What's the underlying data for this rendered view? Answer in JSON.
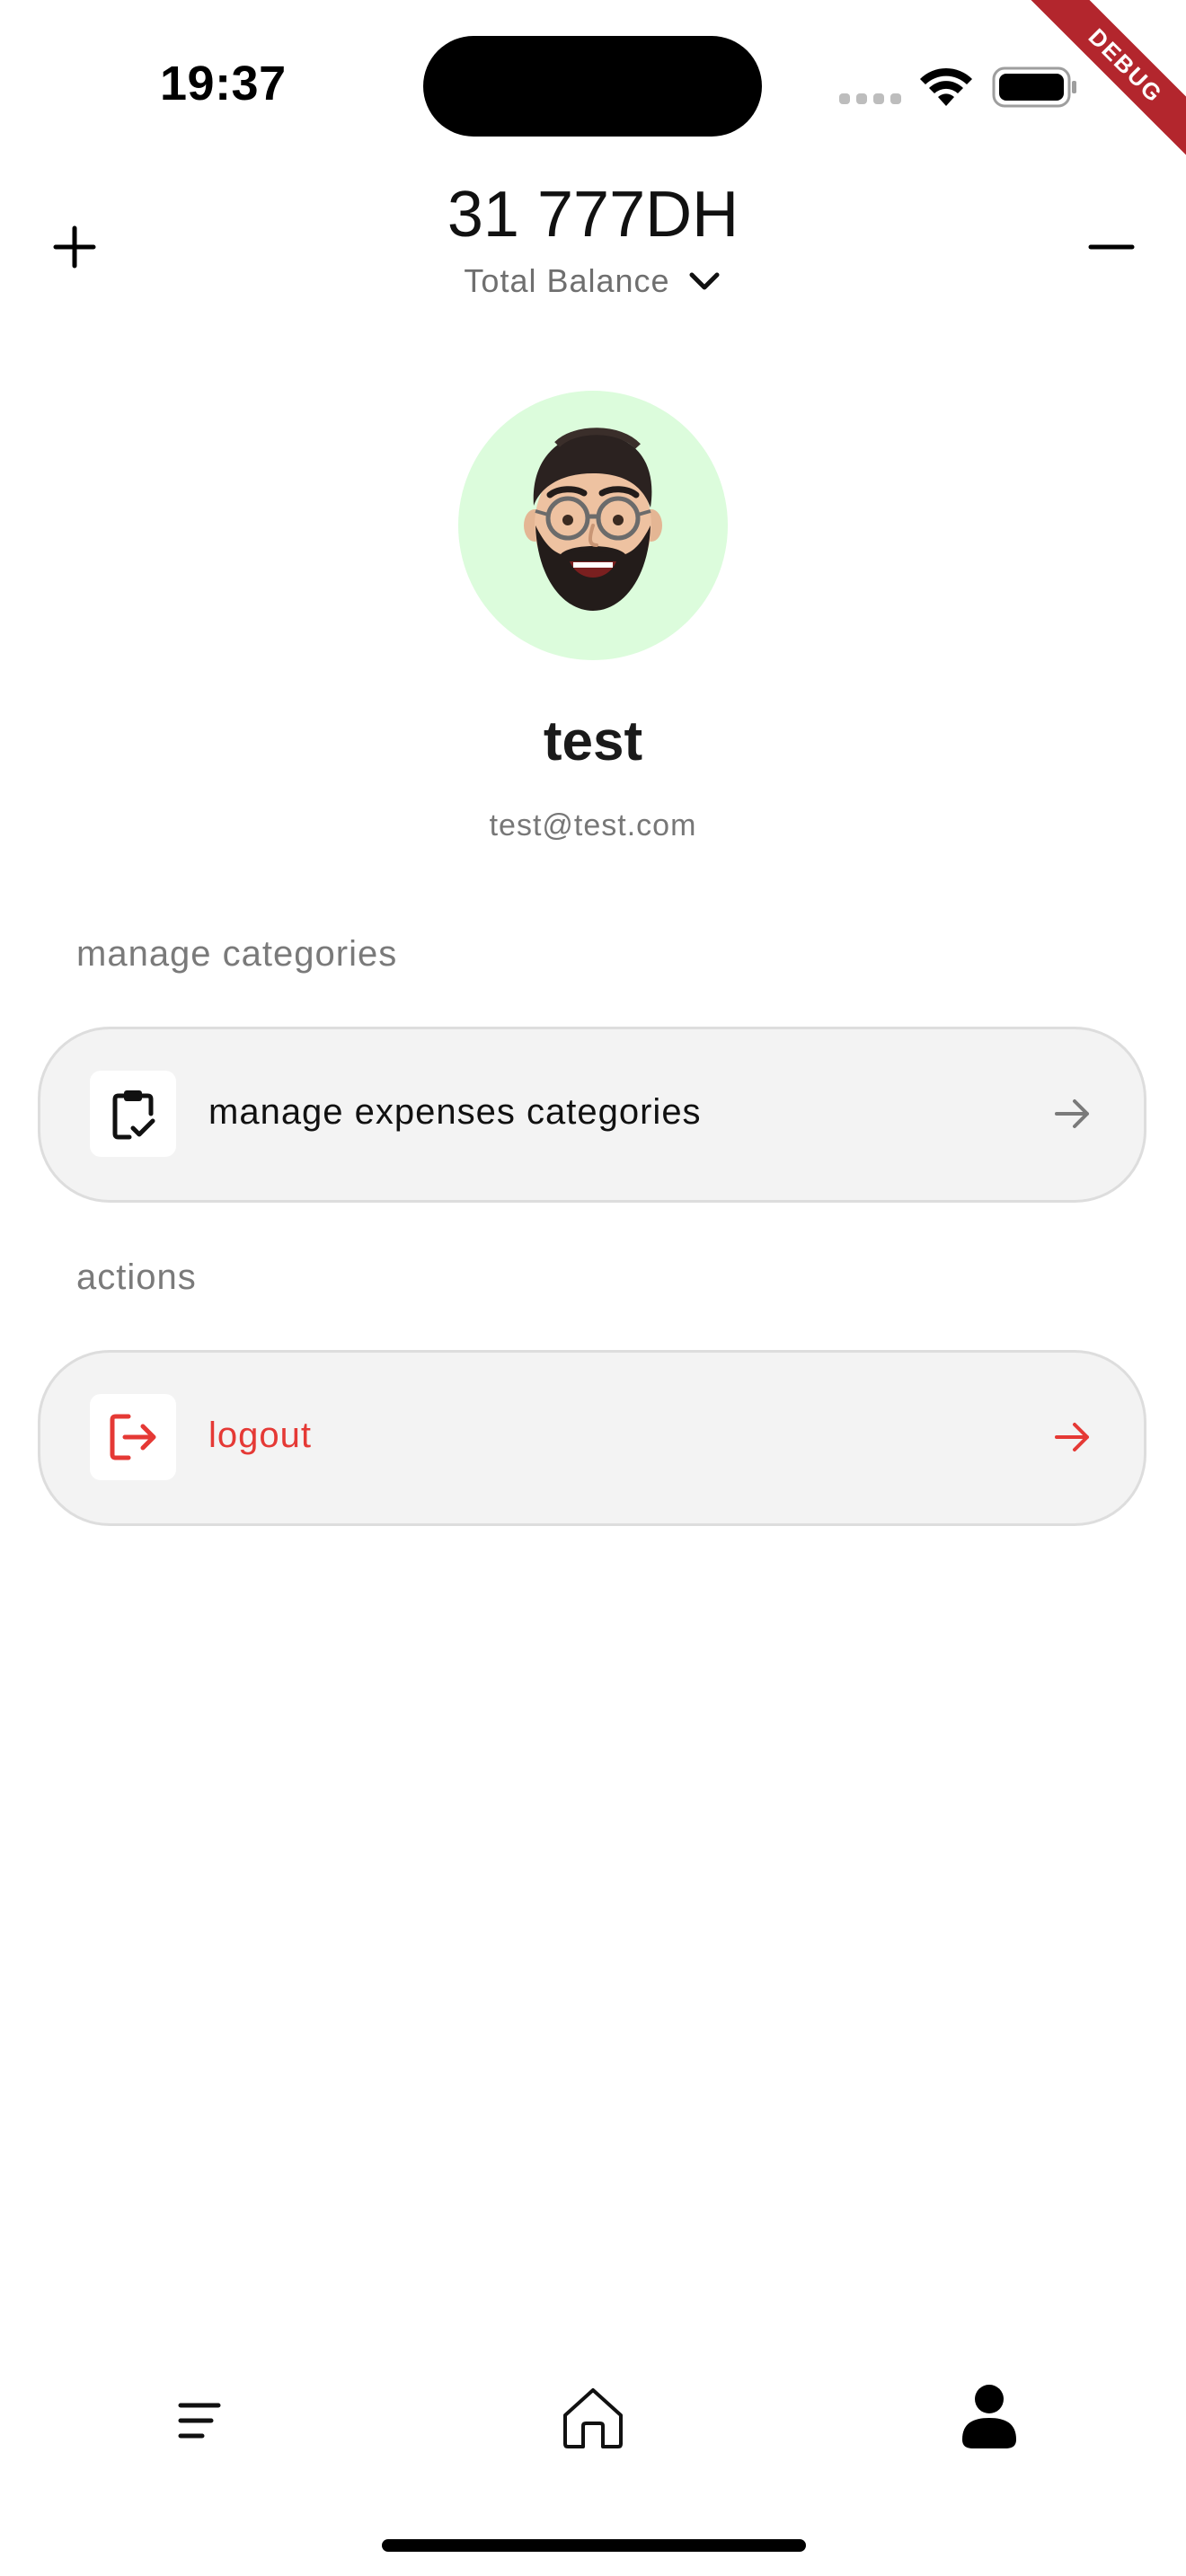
{
  "status_bar": {
    "time": "19:37",
    "wifi_icon": "wifi-icon",
    "battery_icon": "battery-icon",
    "signal_icon": "signal-dots-icon"
  },
  "debug_banner": "DEBUG",
  "header": {
    "balance": "31 777DH",
    "balance_label": "Total Balance",
    "add_icon": "plus-icon",
    "subtract_icon": "minus-icon",
    "dropdown_icon": "chevron-down-icon"
  },
  "profile": {
    "avatar_icon": "memoji-avatar",
    "avatar_bg": "#dcfcdc",
    "name": "test",
    "email": "test@test.com"
  },
  "sections": {
    "categories": {
      "title": "manage categories",
      "item_label": "manage expenses categories",
      "item_icon": "clipboard-check-icon"
    },
    "actions": {
      "title": "actions",
      "item_label": "logout",
      "item_icon": "logout-icon",
      "item_color": "#e53935"
    }
  },
  "bottom_nav": {
    "items": [
      "menu-icon",
      "home-icon",
      "profile-icon"
    ],
    "active": "profile-icon"
  }
}
